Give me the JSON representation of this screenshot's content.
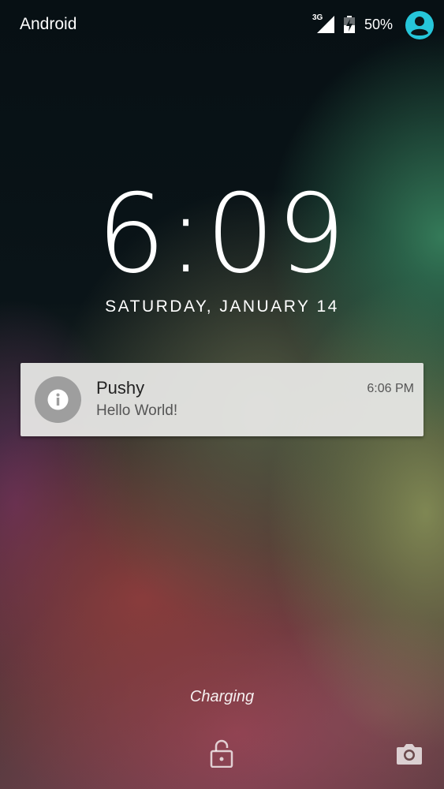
{
  "status_bar": {
    "carrier": "Android",
    "network_type": "3G",
    "battery_percent": "50%",
    "icons": [
      "signal-icon",
      "battery-charging-icon",
      "user-avatar-icon"
    ],
    "accent_color": "#26c6da"
  },
  "lockscreen": {
    "time": "6:09",
    "date": "SATURDAY, JANUARY 14",
    "charging_text": "Charging"
  },
  "notification": {
    "app": "Pushy",
    "message": "Hello World!",
    "time": "6:06 PM",
    "icon": "info-icon"
  },
  "bottom_actions": {
    "left": "unlock-icon",
    "right": "camera-icon"
  }
}
